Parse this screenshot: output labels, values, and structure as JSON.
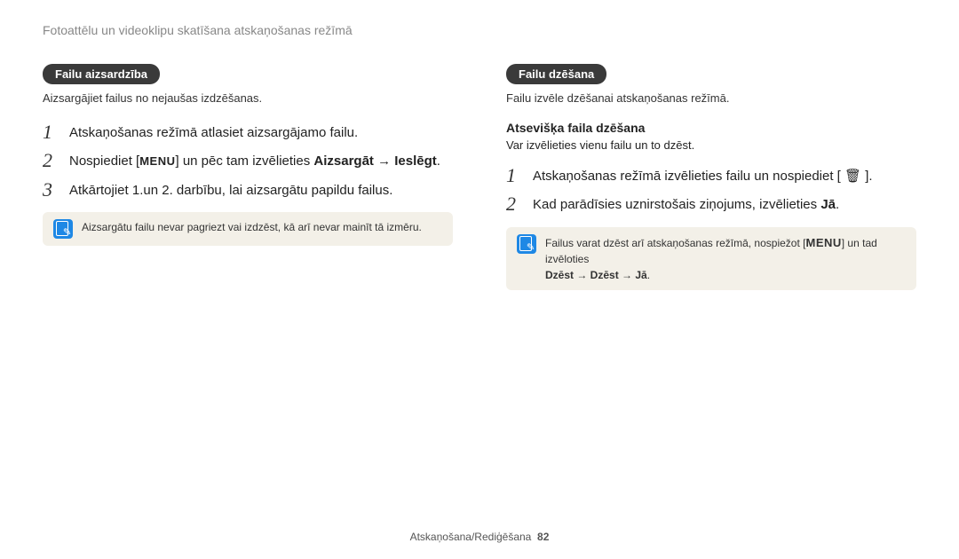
{
  "header": "Fotoattēlu un videoklipu skatīšana atskaņošanas režīmā",
  "left": {
    "pill": "Failu aizsardzība",
    "desc": "Aizsargājiet failus no nejaušas izdzēšanas.",
    "steps": [
      {
        "n": "1",
        "text_plain": "Atskaņošanas režīmā atlasiet aizsargājamo failu."
      },
      {
        "n": "2",
        "pre": "Nospiediet [",
        "post": "] un pēc tam izvēlieties ",
        "bold": "Aizsargāt → Ieslēgt",
        "text_after": "."
      },
      {
        "n": "3",
        "text_plain": "Atkārtojiet 1.un 2. darbību, lai aizsargātu papildu failus."
      }
    ],
    "menu_glyph": "MENU",
    "note": "Aizsargātu failu nevar pagriezt vai izdzēst, kā arī nevar mainīt tā izmēru."
  },
  "right": {
    "pill": "Failu dzēšana",
    "desc": "Failu izvēle dzēšanai atskaņošanas režīmā.",
    "sub_heading": "Atsevišķa faila dzēšana",
    "sub_desc": "Var izvēlieties vienu failu un to dzēst.",
    "steps": [
      {
        "n": "1",
        "pre": "Atskaņošanas režīmā izvēlieties failu un nospiediet [ ",
        "trash": "🗑",
        "post": " ]."
      },
      {
        "n": "2",
        "pre": "Kad parādīsies uznirstošais ziņojums, izvēlieties ",
        "bold": "Jā",
        "post": "."
      }
    ],
    "note_pre": "Failus varat dzēst arī atskaņošanas režīmā, nospiežot [",
    "note_glyph": "MENU",
    "note_post": "] un tad izvēloties ",
    "note_bold": "Dzēst → Dzēst → Jā",
    "note_after": "."
  },
  "footer": {
    "section": "Atskaņošana/Rediģēšana",
    "page": "82"
  }
}
